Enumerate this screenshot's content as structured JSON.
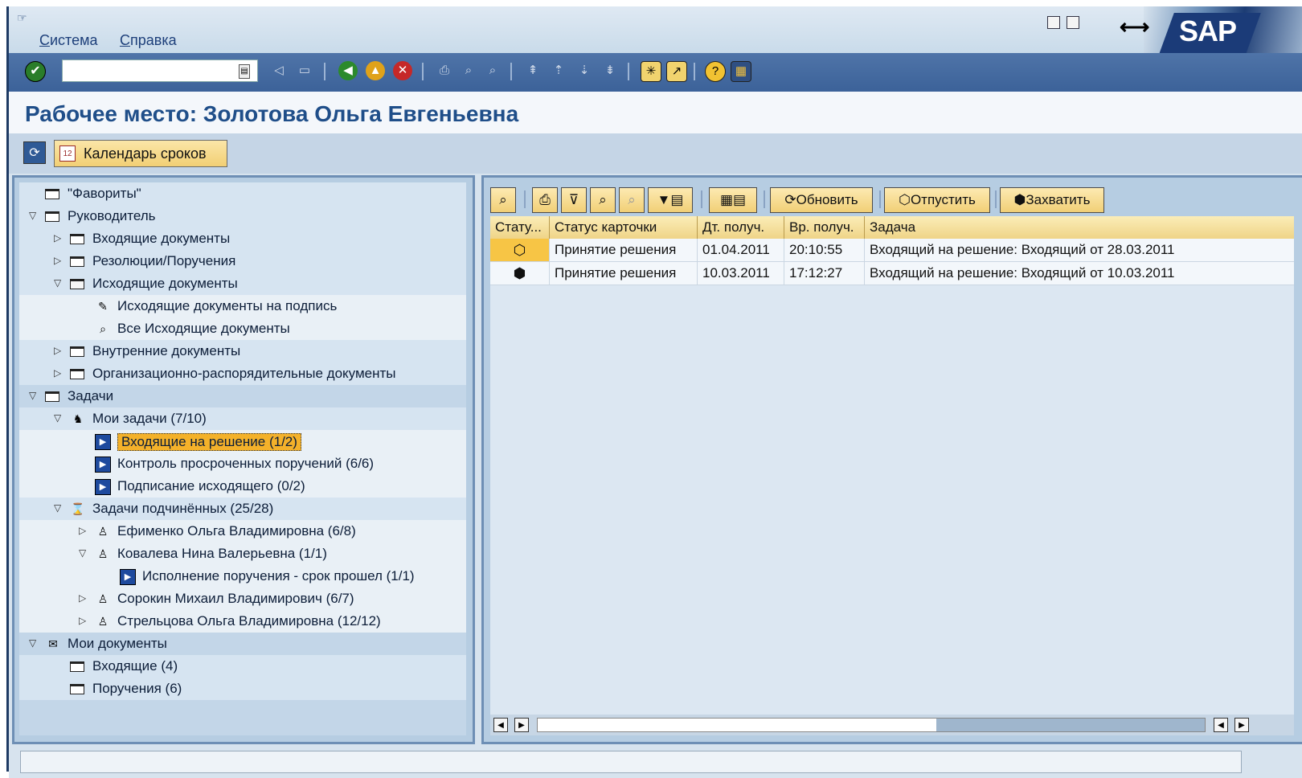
{
  "menu": {
    "items": [
      {
        "label": "Система",
        "underline": "С",
        "rest": "истема"
      },
      {
        "label": "Справка",
        "underline": "С",
        "rest": "правка"
      }
    ]
  },
  "branding": {
    "logo_text": "SAP"
  },
  "toolbar": {
    "command_value": "",
    "icons": [
      "enter-icon",
      "save-icon",
      "back-icon",
      "exit-icon",
      "cancel-icon",
      "print-icon",
      "find-icon",
      "find-next-icon",
      "first-page-icon",
      "prev-page-icon",
      "next-page-icon",
      "last-page-icon",
      "new-session-icon",
      "shortcut-icon",
      "help-icon",
      "layout-icon"
    ]
  },
  "page": {
    "title": "Рабочее место: Золотова Ольга Евгеньевна"
  },
  "app_toolbar": {
    "calendar_label": "Календарь сроков"
  },
  "tree": [
    {
      "level": 0,
      "toggle": "",
      "icon": "folder",
      "label": "\"Фавориты\"",
      "style": "alt"
    },
    {
      "level": 0,
      "toggle": "▽",
      "icon": "folder",
      "label": "Руководитель",
      "style": "alt"
    },
    {
      "level": 1,
      "toggle": "▷",
      "icon": "folder",
      "label": "Входящие документы",
      "style": "alt"
    },
    {
      "level": 1,
      "toggle": "▷",
      "icon": "folder",
      "label": "Резолюции/Поручения",
      "style": "alt"
    },
    {
      "level": 1,
      "toggle": "▽",
      "icon": "folder-open",
      "label": "Исходящие документы",
      "style": "alt"
    },
    {
      "level": 2,
      "toggle": "",
      "icon": "edit",
      "label": "Исходящие документы на подпись",
      "style": "light"
    },
    {
      "level": 2,
      "toggle": "",
      "icon": "binoculars",
      "label": "Все Исходящие документы",
      "style": "light"
    },
    {
      "level": 1,
      "toggle": "▷",
      "icon": "folder",
      "label": "Внутренние документы",
      "style": "alt"
    },
    {
      "level": 1,
      "toggle": "▷",
      "icon": "folder",
      "label": "Организационно-распорядительные документы",
      "style": "alt"
    },
    {
      "level": 0,
      "toggle": "▽",
      "icon": "folder",
      "label": "Задачи",
      "style": "plain"
    },
    {
      "level": 1,
      "toggle": "▽",
      "icon": "person-task",
      "label": "Мои задачи (7/10)",
      "style": "alt"
    },
    {
      "level": 2,
      "toggle": "",
      "icon": "task",
      "label": "Входящие на решение (1/2)",
      "style": "light",
      "selected": true
    },
    {
      "level": 2,
      "toggle": "",
      "icon": "task",
      "label": "Контроль просроченных поручений (6/6)",
      "style": "light"
    },
    {
      "level": 2,
      "toggle": "",
      "icon": "task",
      "label": "Подписание исходящего (0/2)",
      "style": "light"
    },
    {
      "level": 1,
      "toggle": "▽",
      "icon": "hourglass",
      "label": "Задачи подчинённых (25/28)",
      "style": "alt"
    },
    {
      "level": 2,
      "toggle": "▷",
      "icon": "person",
      "label": "Ефименко Ольга Владимировна (6/8)",
      "style": "light"
    },
    {
      "level": 2,
      "toggle": "▽",
      "icon": "person",
      "label": "Ковалева Нина Валерьевна (1/1)",
      "style": "light"
    },
    {
      "level": 3,
      "toggle": "",
      "icon": "task",
      "label": "Исполнение поручения - срок прошел (1/1)",
      "style": "light"
    },
    {
      "level": 2,
      "toggle": "▷",
      "icon": "person",
      "label": "Сорокин Михаил Владимирович (6/7)",
      "style": "light"
    },
    {
      "level": 2,
      "toggle": "▷",
      "icon": "person",
      "label": "Стрельцова Ольга Владимировна (12/12)",
      "style": "light"
    },
    {
      "level": 0,
      "toggle": "▽",
      "icon": "docs",
      "label": "Мои документы",
      "style": "plain"
    },
    {
      "level": 1,
      "toggle": "",
      "icon": "folder",
      "label": "Входящие (4)",
      "style": "alt"
    },
    {
      "level": 1,
      "toggle": "",
      "icon": "folder",
      "label": "Поручения (6)",
      "style": "alt"
    }
  ],
  "grid_toolbar": {
    "refresh_label": "Обновить",
    "release_label": "Отпустить",
    "capture_label": "Захватить"
  },
  "grid": {
    "columns": [
      "Стату...",
      "Статус карточки",
      "Дт. получ.",
      "Вр. получ.",
      "Задача"
    ],
    "rows": [
      {
        "status_icon": "open-box-icon",
        "status": "Принятие решения",
        "date": "01.04.2011",
        "time": "20:10:55",
        "task": "Входящий на решение: Входящий от 28.03.2011"
      },
      {
        "status_icon": "box-icon",
        "status": "Принятие решения",
        "date": "10.03.2011",
        "time": "17:12:27",
        "task": "Входящий на решение: Входящий от 10.03.2011"
      }
    ]
  }
}
